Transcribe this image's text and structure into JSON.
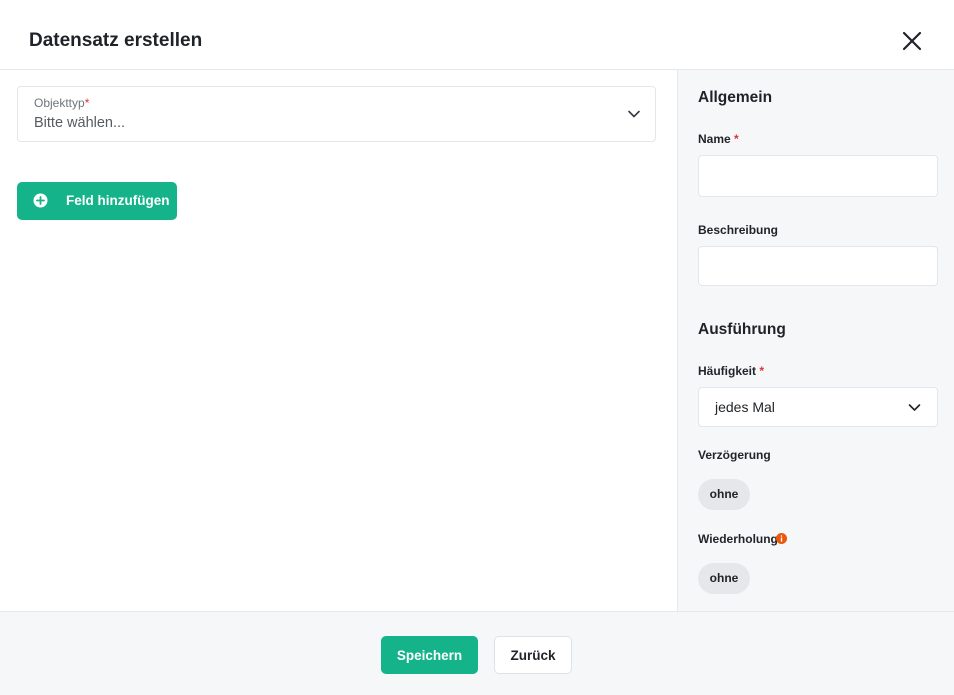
{
  "dialog": {
    "title": "Datensatz erstellen"
  },
  "left": {
    "objekttyp": {
      "label": "Objekttyp",
      "required_mark": "*",
      "value": "Bitte wählen..."
    },
    "add_field_button": "Feld hinzufügen"
  },
  "right": {
    "allgemein_title": "Allgemein",
    "name_label": "Name",
    "name_required": "*",
    "name_value": "",
    "beschreibung_label": "Beschreibung",
    "beschreibung_value": "",
    "ausfuehrung_title": "Ausführung",
    "haeufigkeit_label": "Häufigkeit",
    "haeufigkeit_required": "*",
    "haeufigkeit_value": "jedes Mal",
    "verzoegerung_label": "Verzögerung",
    "verzoegerung_value": "ohne",
    "wiederholung_label": "Wiederholung",
    "wiederholung_value": "ohne"
  },
  "footer": {
    "save_label": "Speichern",
    "back_label": "Zurück"
  },
  "colors": {
    "accent": "#14b38a",
    "required": "#e03131",
    "info": "#e8590c"
  }
}
